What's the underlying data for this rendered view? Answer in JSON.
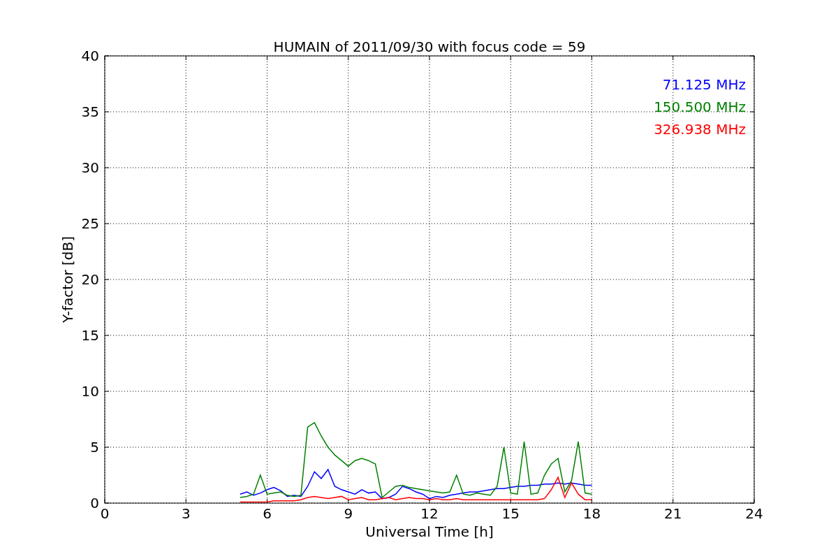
{
  "chart_data": {
    "type": "line",
    "title": "HUMAIN of 2011/09/30 with focus code = 59",
    "xlabel": "Universal Time [h]",
    "ylabel": "Y-factor [dB]",
    "x": [
      5,
      5.25,
      5.5,
      5.75,
      6,
      6.25,
      6.5,
      6.75,
      7,
      7.25,
      7.5,
      7.75,
      8,
      8.25,
      8.5,
      8.75,
      9,
      9.25,
      9.5,
      9.75,
      10,
      10.25,
      10.5,
      10.75,
      11,
      11.25,
      11.5,
      11.75,
      12,
      12.25,
      12.5,
      12.75,
      13,
      13.25,
      13.5,
      13.75,
      14,
      14.25,
      14.5,
      14.75,
      15,
      15.25,
      15.5,
      15.75,
      16,
      16.25,
      16.5,
      16.75,
      17,
      17.25,
      17.5,
      17.75,
      18
    ],
    "series": [
      {
        "name": "71.125 MHz",
        "color": "#0000ff",
        "values": [
          0.8,
          1.0,
          0.7,
          0.9,
          1.2,
          1.4,
          1.1,
          0.6,
          0.7,
          0.6,
          1.5,
          2.8,
          2.2,
          3.0,
          1.5,
          1.2,
          1.0,
          0.8,
          1.2,
          0.9,
          1.0,
          0.4,
          0.5,
          0.8,
          1.5,
          1.3,
          1.0,
          0.8,
          0.4,
          0.6,
          0.5,
          0.7,
          0.8,
          0.9,
          1.0,
          1.0,
          1.1,
          1.2,
          1.3,
          1.3,
          1.4,
          1.5,
          1.5,
          1.6,
          1.6,
          1.7,
          1.7,
          1.8,
          1.7,
          1.8,
          1.7,
          1.6,
          1.6
        ]
      },
      {
        "name": "150.500 MHz",
        "color": "#008000",
        "values": [
          0.5,
          0.6,
          0.8,
          2.5,
          0.8,
          0.9,
          1.0,
          0.7,
          0.6,
          0.7,
          6.8,
          7.2,
          6.0,
          5.0,
          4.3,
          3.8,
          3.3,
          3.8,
          4.0,
          3.8,
          3.5,
          0.5,
          1.0,
          1.5,
          1.6,
          1.4,
          1.3,
          1.2,
          1.1,
          1.0,
          0.9,
          1.0,
          2.5,
          0.8,
          0.7,
          0.9,
          0.8,
          0.7,
          1.5,
          5.0,
          0.9,
          0.8,
          5.5,
          0.8,
          0.9,
          2.5,
          3.5,
          4.0,
          1.0,
          2.0,
          5.5,
          0.9,
          0.8
        ]
      },
      {
        "name": "326.938 MHz",
        "color": "#ff0000",
        "values": [
          0.1,
          0.1,
          0.1,
          0.1,
          0.1,
          0.2,
          0.2,
          0.2,
          0.2,
          0.3,
          0.5,
          0.6,
          0.5,
          0.4,
          0.5,
          0.6,
          0.3,
          0.4,
          0.5,
          0.3,
          0.3,
          0.4,
          0.5,
          0.3,
          0.4,
          0.5,
          0.4,
          0.4,
          0.3,
          0.4,
          0.3,
          0.3,
          0.4,
          0.3,
          0.3,
          0.3,
          0.3,
          0.3,
          0.3,
          0.3,
          0.3,
          0.3,
          0.3,
          0.3,
          0.3,
          0.4,
          1.2,
          2.3,
          0.5,
          1.8,
          0.8,
          0.3,
          0.3
        ]
      }
    ],
    "xlim": [
      0,
      24
    ],
    "ylim": [
      0,
      40
    ],
    "xticks": [
      0,
      3,
      6,
      9,
      12,
      15,
      18,
      21,
      24
    ],
    "yticks": [
      0,
      5,
      10,
      15,
      20,
      25,
      30,
      35,
      40
    ],
    "grid": true
  }
}
